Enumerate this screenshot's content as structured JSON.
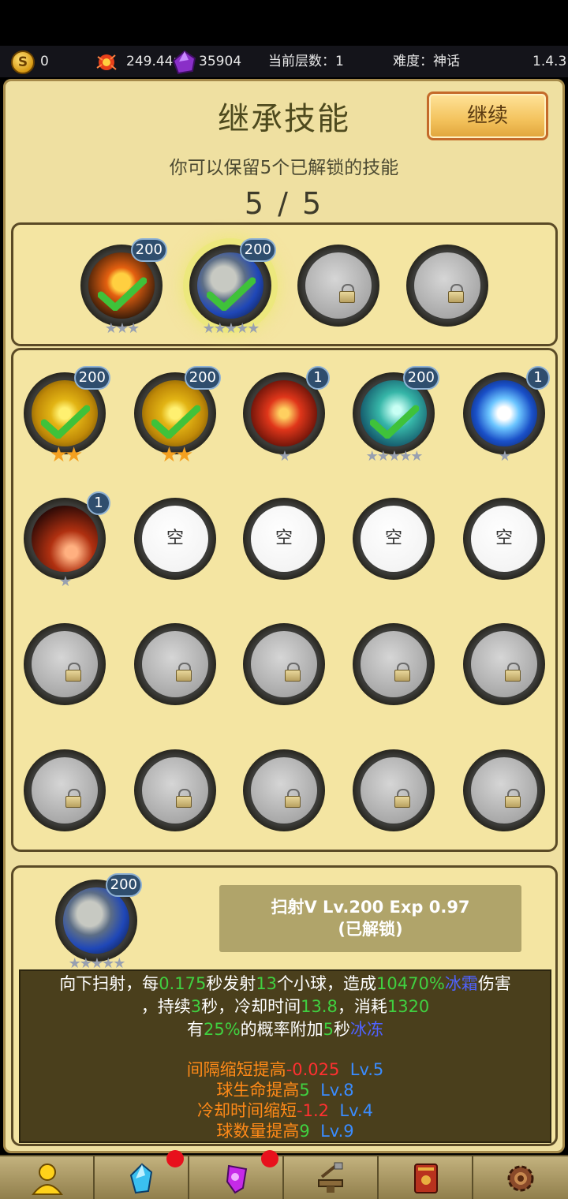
{
  "topbar": {
    "gold": "0",
    "fire": "249.44r",
    "gem": "35904",
    "floor_label": "当前层数：1",
    "difficulty_label": "难度：神话",
    "version": "1.4.3"
  },
  "header": {
    "title": "继承技能",
    "continue_label": "继续",
    "subtitle": "你可以保留5个已解锁的技能",
    "counter": "5 / 5"
  },
  "selected": [
    {
      "art": "cross",
      "level": "200",
      "stars": "★★★",
      "checked": true
    },
    {
      "art": "rock",
      "level": "200",
      "stars": "★★★★★",
      "checked": true,
      "highlight": true
    },
    {
      "locked": true
    },
    {
      "locked": true
    }
  ],
  "skills_row1": [
    {
      "art": "gold",
      "level": "200",
      "stars": "★★",
      "gold": true,
      "checked": true
    },
    {
      "art": "gold",
      "level": "200",
      "stars": "★★",
      "gold": true,
      "checked": true
    },
    {
      "art": "fire",
      "level": "1",
      "stars": "★"
    },
    {
      "art": "wind",
      "level": "200",
      "stars": "★★★★★",
      "checked": true
    },
    {
      "art": "ice",
      "level": "1",
      "stars": "★"
    }
  ],
  "skills_row2": [
    {
      "art": "meteor",
      "level": "1",
      "stars": "★"
    },
    {
      "empty": "空"
    },
    {
      "empty": "空"
    },
    {
      "empty": "空"
    },
    {
      "empty": "空"
    }
  ],
  "detail": {
    "level": "200",
    "stars": "★★★★★",
    "name_line": "扫射V Lv.200  Exp 0.97",
    "status_line": "(已解锁)",
    "desc": {
      "a1": "向下扫射，每",
      "a2": "0.175",
      "a3": "秒发射",
      "a4": "13",
      "a5": "个小球，造成",
      "a6": "10470%",
      "a7": "冰霜",
      "a8": "伤害",
      "b1": "，持续",
      "b2": "3",
      "b3": "秒，冷却时间",
      "b4": "13.8",
      "b5": "，消耗",
      "b6": "1320",
      "c1": "有",
      "c2": "25%",
      "c3": "的概率附加",
      "c4": "5",
      "c5": "秒",
      "c6": "冰冻",
      "u1a": "间隔缩短提高",
      "u1b": "-0.025",
      "u1c": "Lv.5",
      "u2a": "球生命提高",
      "u2b": "5",
      "u2c": "Lv.8",
      "u3a": "冷却时间缩短",
      "u3b": "-1.2",
      "u3c": "Lv.4",
      "u4a": "球数量提高",
      "u4b": "9",
      "u4c": "Lv.9"
    }
  },
  "nav": [
    "hero-icon",
    "crystal-icon",
    "potion-icon",
    "forge-icon",
    "book-icon",
    "gear-icon"
  ]
}
